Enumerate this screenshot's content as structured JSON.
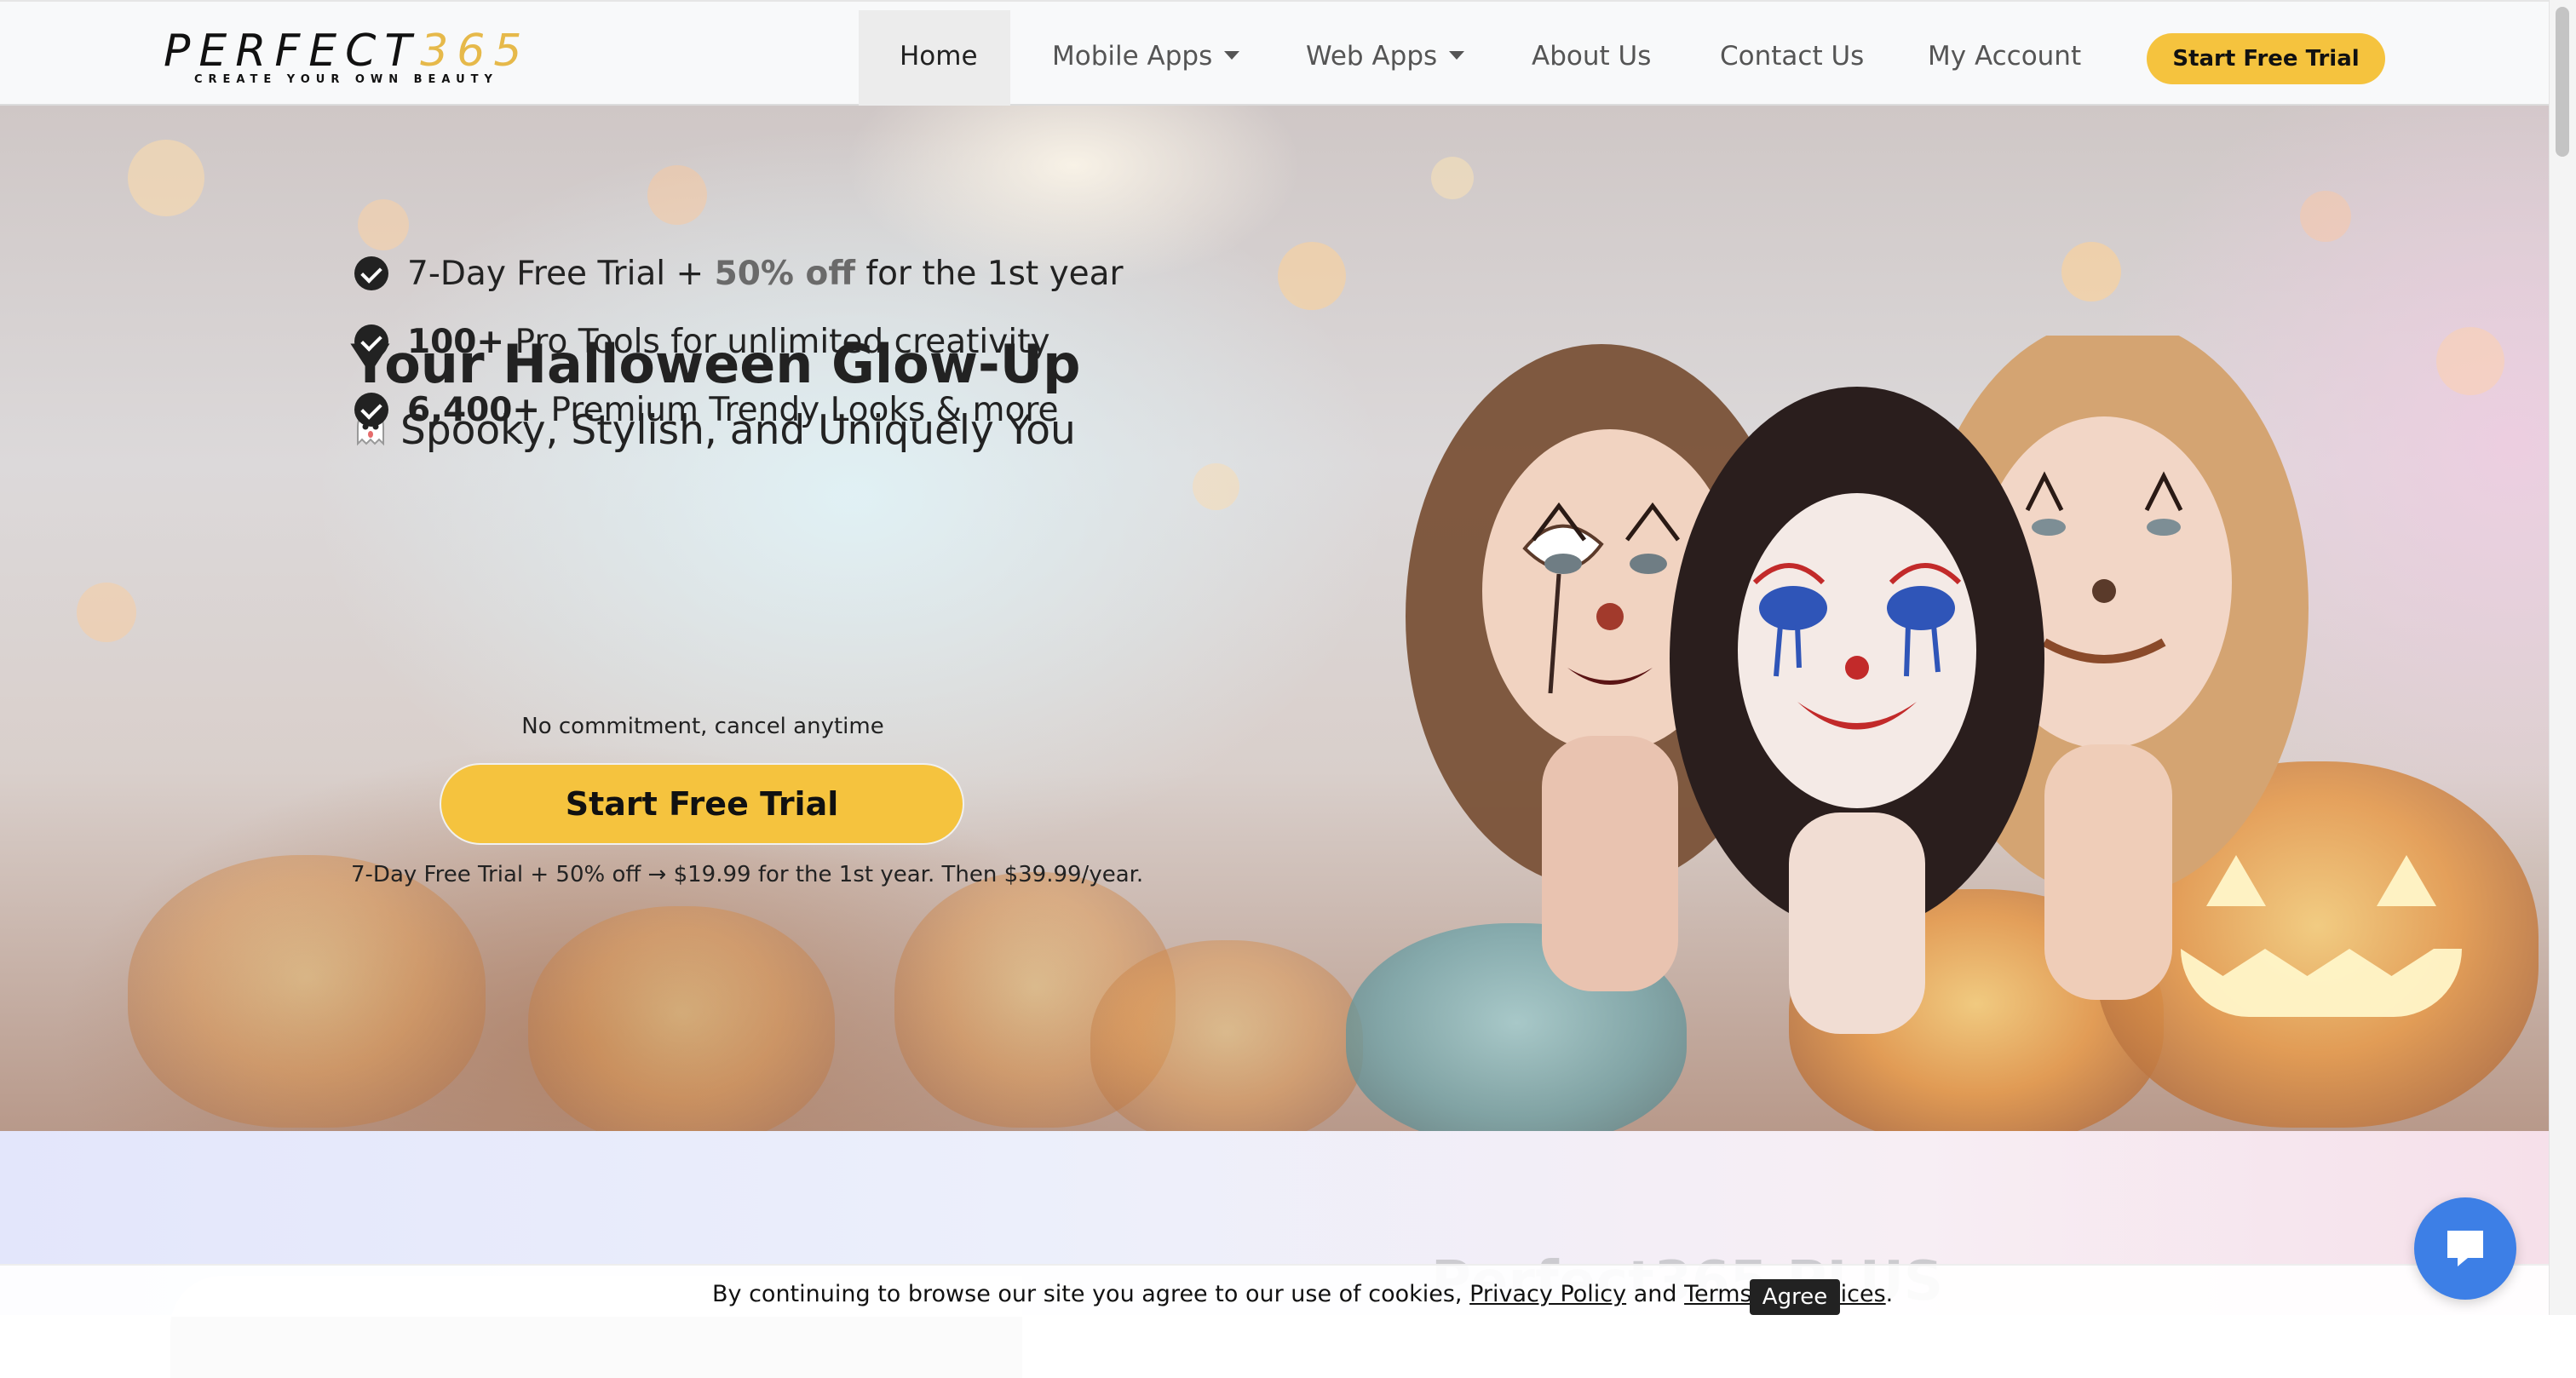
{
  "header": {
    "logo_word": "PERFECT",
    "logo_number": "365",
    "logo_tagline": "CREATE YOUR OWN BEAUTY",
    "nav": {
      "home": "Home",
      "mobile_apps": "Mobile Apps",
      "web_apps": "Web Apps",
      "about": "About Us",
      "contact": "Contact Us",
      "account": "My Account"
    },
    "cta": "Start Free Trial"
  },
  "hero": {
    "title": "Your Halloween Glow-Up",
    "subtitle": "Spooky, Stylish, and Uniquely You",
    "bullets": [
      {
        "pre": "7-Day Free Trial + ",
        "highlight": "50% off",
        "post": " for the 1st year"
      },
      {
        "strong": "100+",
        "post": " Pro Tools for unlimited creativity"
      },
      {
        "strong": "6,400+",
        "post": " Premium Trendy Looks & more"
      }
    ],
    "no_commitment": "No commitment, cancel anytime",
    "cta": "Start Free Trial",
    "fine_print": "7-Day Free Trial + 50% off → $19.99 for the 1st year. Then $39.99/year."
  },
  "below": {
    "heading_partial": "Perfect365 PLUS"
  },
  "cookie": {
    "text_pre": "By continuing to browse our site you agree to our use of cookies, ",
    "privacy": "Privacy Policy",
    "and": " and ",
    "terms": "Terms of Services",
    "period": ".",
    "agree": "Agree"
  },
  "colors": {
    "accent": "#f5c33e",
    "logo_gold": "#e6b94a",
    "chat": "#3d7fe6"
  },
  "icons": [
    "ghost-icon",
    "check-circle-icon",
    "chevron-down-icon",
    "chat-icon"
  ]
}
